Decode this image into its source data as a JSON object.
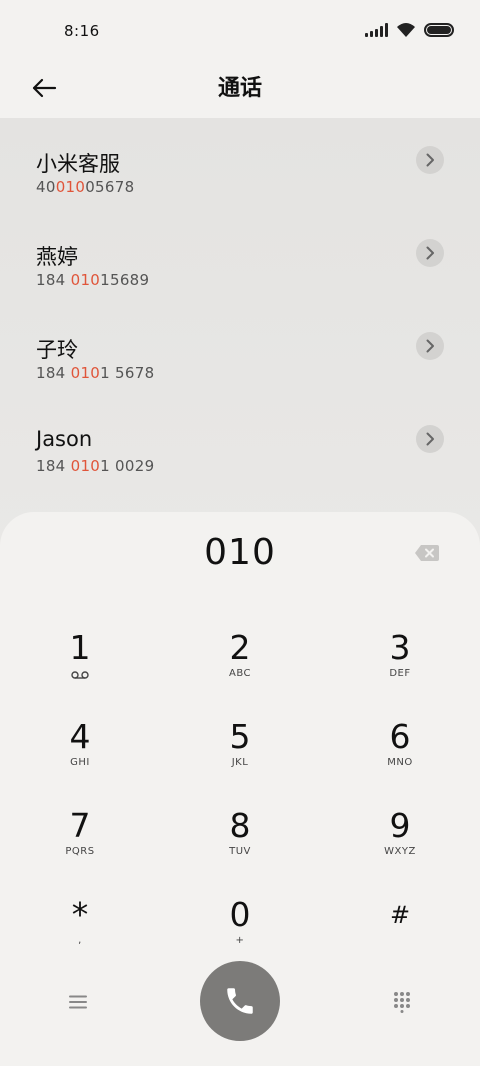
{
  "status": {
    "time": "8:16"
  },
  "header": {
    "title": "通话"
  },
  "results": [
    {
      "name": "小米客服",
      "number_pre": "40",
      "number_hl": "010",
      "number_post": "05678"
    },
    {
      "name": "燕婷",
      "number_pre": "184 ",
      "number_hl": "010",
      "number_post": "15689"
    },
    {
      "name": "子玲",
      "number_pre": "184 ",
      "number_hl": "010",
      "number_post": "1 5678"
    },
    {
      "name": "Jason",
      "number_pre": "184 ",
      "number_hl": "010",
      "number_post": "1 0029"
    }
  ],
  "dialer": {
    "input": "010",
    "keys": [
      {
        "digit": "1",
        "letters": "",
        "sub_icon": "voicemail-icon"
      },
      {
        "digit": "2",
        "letters": "ABC"
      },
      {
        "digit": "3",
        "letters": "DEF"
      },
      {
        "digit": "4",
        "letters": "GHI"
      },
      {
        "digit": "5",
        "letters": "JKL"
      },
      {
        "digit": "6",
        "letters": "MNO"
      },
      {
        "digit": "7",
        "letters": "PQRS"
      },
      {
        "digit": "8",
        "letters": "TUV"
      },
      {
        "digit": "9",
        "letters": "WXYZ"
      },
      {
        "digit": "*",
        "letters": ","
      },
      {
        "digit": "0",
        "letters": "+"
      },
      {
        "digit": "#",
        "letters": ""
      }
    ]
  },
  "colors": {
    "highlight": "#e0553a",
    "call_button": "#7c7b79",
    "background": "#f3f2f0"
  }
}
